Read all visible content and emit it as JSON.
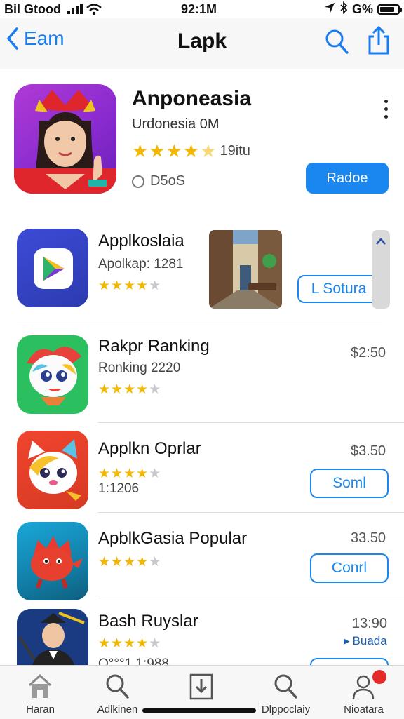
{
  "status": {
    "carrier": "Bil Gtood",
    "time": "92:1M",
    "battery": "G%"
  },
  "nav": {
    "back_label": "Eam",
    "title": "Lapk"
  },
  "featured": {
    "name": "Anponeasia",
    "subtitle": "Urdonesia 0M",
    "rating_count": "19itu",
    "info": "D5oS",
    "action_label": "Radoe"
  },
  "apps": [
    {
      "name": "Applkoslaia",
      "sub": "Apolkap: 1281",
      "stars": 4.5,
      "action_label": "L Sotura"
    },
    {
      "name": "Rakpr Ranking",
      "sub": "Ronking 2220",
      "stars": 4.5,
      "price": "$2:50"
    },
    {
      "name": "Applkn Oprlar",
      "sub": "1:1206",
      "stars": 4.5,
      "price": "$3.50",
      "action_label": "Soml"
    },
    {
      "name": "ApblkGasia Popular",
      "stars": 4.5,
      "price": "33.50",
      "action_label": "Conrl"
    },
    {
      "name": "Bash Ruyslar",
      "sub": "O°°°1 1:988",
      "stars": 4.5,
      "price": "13:90",
      "action_label": "Buada"
    }
  ],
  "tabs": [
    {
      "label": "Haran",
      "icon": "home-icon"
    },
    {
      "label": "Adlkinen",
      "icon": "search-icon"
    },
    {
      "label": "",
      "icon": "download-box-icon"
    },
    {
      "label": "Dlppoclaiy",
      "icon": "search-icon"
    },
    {
      "label": "Nioatara",
      "icon": "profile-icon",
      "badge": ""
    }
  ],
  "colors": {
    "accent": "#1a86f0",
    "star": "#f2b705",
    "badge": "#e52a2a"
  }
}
